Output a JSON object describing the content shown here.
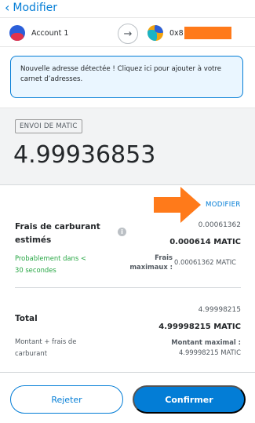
{
  "header": {
    "back_label": "Modifier"
  },
  "accounts": {
    "from_name": "Account 1",
    "to_address_prefix": "0x8"
  },
  "alert": {
    "text": "Nouvelle adresse détectée ! Cliquez ici pour ajouter à votre carnet d’adresses."
  },
  "send": {
    "tag": "ENVOI DE MATIC",
    "amount": "4.99936853"
  },
  "gas": {
    "modify_label": "MODIFIER",
    "label_line1": "Frais de carburant",
    "label_line2": "estimés",
    "value_small": "0.00061362",
    "value_bold": "0.000614 MATIC",
    "timing_line1": "Probablement dans <",
    "timing_line2": "30 secondes",
    "max_label_line1": "Frais",
    "max_label_line2": "maximaux :",
    "max_value": "0.00061362 MATIC"
  },
  "total": {
    "label": "Total",
    "value_small": "4.99998215",
    "value_bold": "4.99998215 MATIC",
    "desc_line1": "Montant + frais de",
    "desc_line2": "carburant",
    "max_label": "Montant maximal :",
    "max_value": "4.99998215 MATIC"
  },
  "footer": {
    "reject_label": "Rejeter",
    "confirm_label": "Confirmer"
  },
  "colors": {
    "accent": "#037dd6",
    "success": "#28a745",
    "annotation": "#ff7a1a"
  }
}
